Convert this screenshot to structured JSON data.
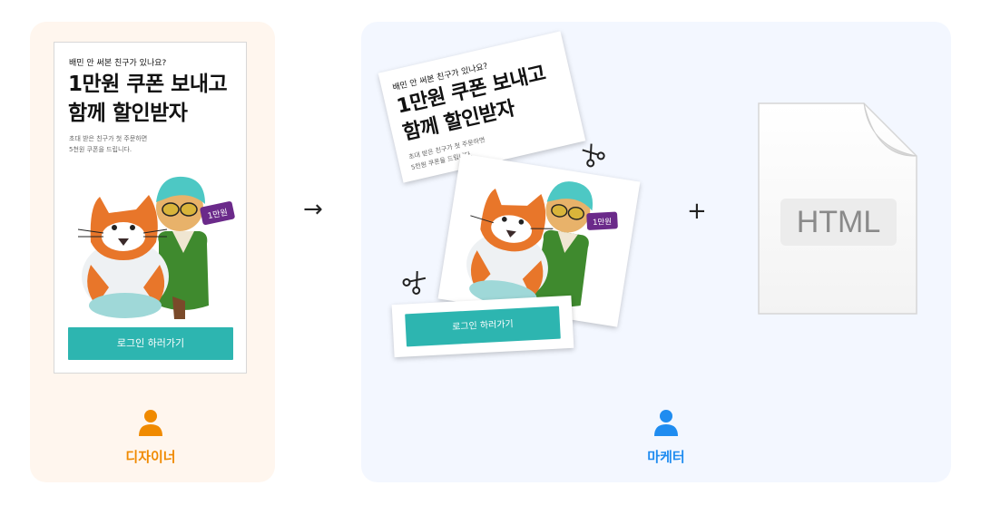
{
  "designer": {
    "role_label": "디자이너",
    "role_color": "#f08a00"
  },
  "marketer": {
    "role_label": "마케터",
    "role_color": "#1f8cf0"
  },
  "banner": {
    "eyebrow": "배민 안 써본 친구가 있나요?",
    "headline_line1": "1만원 쿠폰 보내고",
    "headline_line2": "함께 할인받자",
    "sub_line1": "초대 받은 친구가 첫 주문하면",
    "sub_line2": "5천원 쿠폰을 드립니다.",
    "ticket_text": "1만원",
    "cta_label": "로그인 하러가기",
    "cta_color": "#2db5b0"
  },
  "operators": {
    "arrow": "→",
    "plus": "+"
  },
  "file": {
    "badge_text": "HTML"
  },
  "icons": [
    "user-icon",
    "scissors-icon",
    "document-icon",
    "arrow-right-icon",
    "plus-icon"
  ]
}
